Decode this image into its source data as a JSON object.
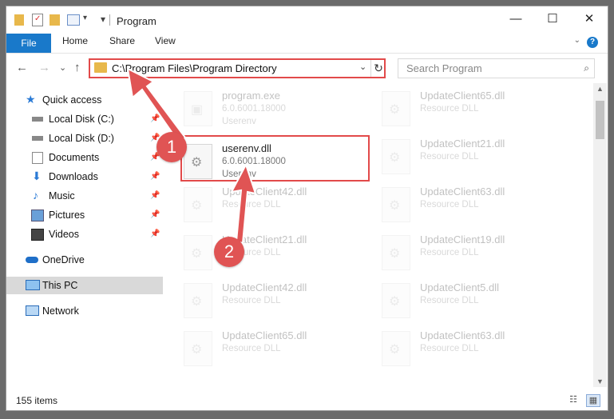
{
  "window": {
    "title": "Program"
  },
  "titlebar_controls": {
    "minimize": "—",
    "maximize": "☐",
    "close": "✕"
  },
  "ribbon": {
    "file": "File",
    "tabs": [
      "Home",
      "Share",
      "View"
    ],
    "help": "?",
    "collapse": "⌄"
  },
  "nav": {
    "back": "←",
    "forward": "→",
    "recent": "⌄",
    "up": "↑",
    "address": "C:\\Program Files\\Program Directory",
    "refresh": "↻",
    "search_placeholder": "Search Program",
    "search_icon": "⌕"
  },
  "sidebar": {
    "items": [
      {
        "label": "Quick access",
        "icon": "star-icon"
      },
      {
        "label": "Local Disk (C:)",
        "icon": "drive-icon",
        "pinned": true
      },
      {
        "label": "Local Disk (D:)",
        "icon": "drive-icon",
        "pinned": true
      },
      {
        "label": "Documents",
        "icon": "documents-icon",
        "pinned": true
      },
      {
        "label": "Downloads",
        "icon": "downloads-icon",
        "pinned": true
      },
      {
        "label": "Music",
        "icon": "music-icon",
        "pinned": true
      },
      {
        "label": "Pictures",
        "icon": "pictures-icon",
        "pinned": true
      },
      {
        "label": "Videos",
        "icon": "videos-icon",
        "pinned": true
      },
      {
        "label": "OneDrive",
        "icon": "cloud-icon"
      },
      {
        "label": "This PC",
        "icon": "computer-icon",
        "selected": true
      },
      {
        "label": "Network",
        "icon": "network-icon"
      }
    ],
    "pin_glyph": "📌"
  },
  "files": [
    {
      "name": "program.exe",
      "line1": "6.0.6001.18000",
      "line2": "Userenv",
      "faded": true
    },
    {
      "name": "UpdateClient65.dll",
      "line1": "Resource DLL",
      "line2": "",
      "faded": true
    },
    {
      "name": "userenv.dll",
      "line1": "6.0.6001.18000",
      "line2": "Userenv",
      "faded": false
    },
    {
      "name": "UpdateClient21.dll",
      "line1": "Resource DLL",
      "line2": "",
      "faded": true
    },
    {
      "name": "UpdateClient42.dll",
      "line1": "Resource DLL",
      "line2": "",
      "faded": true
    },
    {
      "name": "UpdateClient63.dll",
      "line1": "Resource DLL",
      "line2": "",
      "faded": true
    },
    {
      "name": "UpdateClient21.dll",
      "line1": "Resource DLL",
      "line2": "",
      "faded": true
    },
    {
      "name": "UpdateClient19.dll",
      "line1": "Resource DLL",
      "line2": "",
      "faded": true
    },
    {
      "name": "UpdateClient42.dll",
      "line1": "Resource DLL",
      "line2": "",
      "faded": true
    },
    {
      "name": "UpdateClient5.dll",
      "line1": "Resource DLL",
      "line2": "",
      "faded": true
    },
    {
      "name": "UpdateClient65.dll",
      "line1": "Resource DLL",
      "line2": "",
      "faded": true
    },
    {
      "name": "UpdateClient63.dll",
      "line1": "Resource DLL",
      "line2": "",
      "faded": true
    }
  ],
  "status": {
    "count": "155 items"
  },
  "annotations": {
    "badge1": "1",
    "badge2": "2",
    "color": "#e05454"
  },
  "colors": {
    "accent": "#1979ca",
    "highlight": "#e24a4a",
    "folder": "#e8b84b"
  }
}
